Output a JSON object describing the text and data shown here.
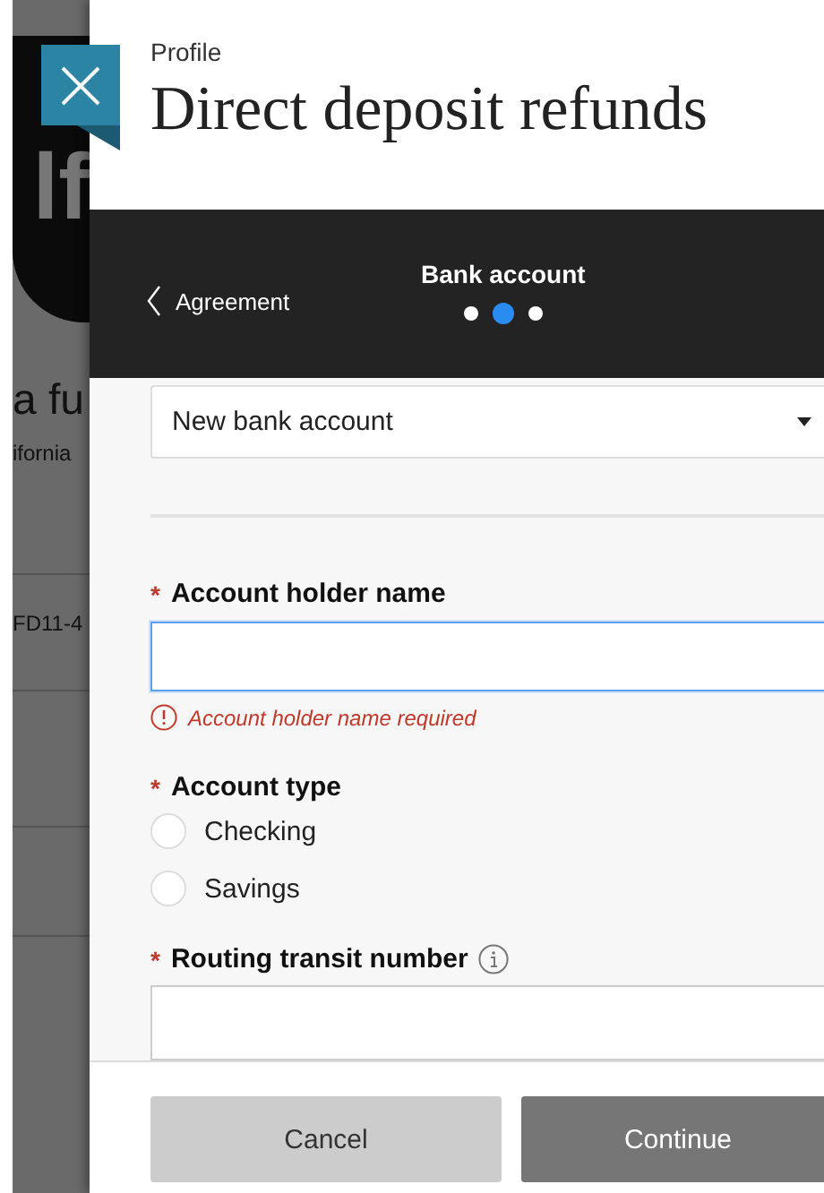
{
  "background": {
    "texts": [
      "lf",
      "a fu",
      "ifornia",
      "FD11-4"
    ]
  },
  "header": {
    "eyebrow": "Profile",
    "title": "Direct deposit refunds"
  },
  "nav": {
    "back": "Agreement",
    "step_title": "Bank account",
    "steps": [
      {
        "selected": false
      },
      {
        "selected": true
      },
      {
        "selected": false
      }
    ]
  },
  "account_select": {
    "value": "New bank account"
  },
  "holder_name": {
    "required_mark": "*",
    "label": "Account holder name",
    "focused": true,
    "error": "Account holder name required"
  },
  "account_type": {
    "required_mark": "*",
    "label": "Account type",
    "options": [
      {
        "label": "Checking",
        "selected": false
      },
      {
        "label": "Savings",
        "selected": false
      }
    ]
  },
  "routing": {
    "required_mark": "*",
    "label": "Routing transit number"
  },
  "buttons": [
    {
      "label": "Cancel",
      "kind": "secondary"
    },
    {
      "label": "Continue",
      "kind": "primary"
    }
  ]
}
